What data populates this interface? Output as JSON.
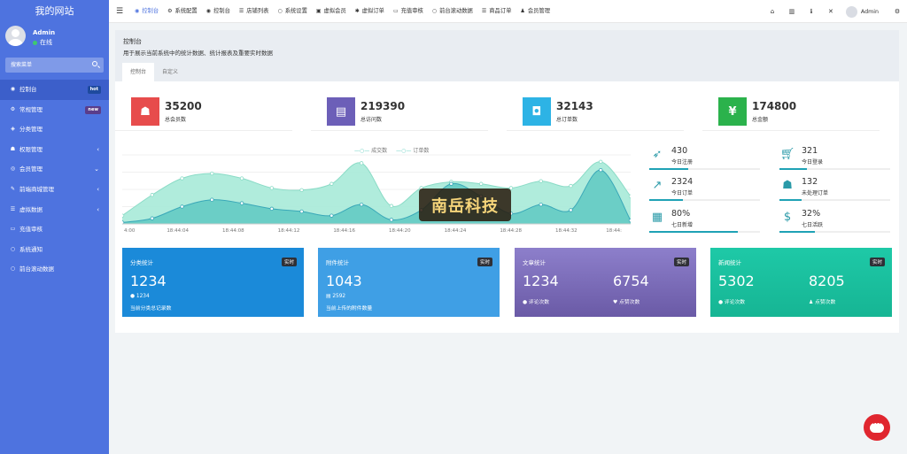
{
  "sidebar": {
    "logo": "我的网站",
    "user_name": "Admin",
    "user_status": "在线",
    "search_placeholder": "搜索菜单",
    "items": [
      {
        "label": "控制台",
        "icon": "dashboard-icon",
        "badge": "hot"
      },
      {
        "label": "常规管理",
        "icon": "cogs-icon",
        "badge": "new"
      },
      {
        "label": "分类管理",
        "icon": "tags-icon"
      },
      {
        "label": "权限管理",
        "icon": "group-icon",
        "arrow": "‹"
      },
      {
        "label": "会员管理",
        "icon": "user-circle-icon",
        "arrow": "⌄"
      },
      {
        "label": "前端商城管理",
        "icon": "magic-icon",
        "arrow": "‹"
      },
      {
        "label": "虚拟数据",
        "icon": "list-icon",
        "arrow": "‹"
      },
      {
        "label": "充值审核",
        "icon": "keyboard-icon"
      },
      {
        "label": "系统通知",
        "icon": "circle-icon"
      },
      {
        "label": "前台滚动数据",
        "icon": "circle-icon"
      }
    ]
  },
  "topbar": {
    "tabs": [
      {
        "label": "控制台",
        "icon": "dashboard-icon"
      },
      {
        "label": "系统配置",
        "icon": "gear-icon"
      },
      {
        "label": "控制台",
        "icon": "dashboard-icon"
      },
      {
        "label": "店铺列表",
        "icon": "list-icon"
      },
      {
        "label": "系统设置",
        "icon": "circle-icon"
      },
      {
        "label": "虚拟会员",
        "icon": "square-icon"
      },
      {
        "label": "虚拟订单",
        "icon": "asterisk-icon"
      },
      {
        "label": "充值审核",
        "icon": "keyboard-icon"
      },
      {
        "label": "前台滚动数据",
        "icon": "circle-icon"
      },
      {
        "label": "商品订单",
        "icon": "list-icon"
      },
      {
        "label": "会员管理",
        "icon": "user-icon"
      }
    ],
    "admin_name": "Admin"
  },
  "panel": {
    "title": "控制台",
    "description": "用于展示当前系统中的统计数据、统计报表及重要实时数据",
    "tabs": [
      "控制台",
      "自定义"
    ]
  },
  "stats": [
    {
      "value": "35200",
      "label": "总会员数",
      "color": "#e74c4c",
      "icon": "users-icon"
    },
    {
      "value": "219390",
      "label": "总访问数",
      "color": "#6c5fb8",
      "icon": "book-icon"
    },
    {
      "value": "32143",
      "label": "总订单数",
      "color": "#2db3e5",
      "icon": "shopping-bag-icon"
    },
    {
      "value": "174800",
      "label": "总金额",
      "color": "#2bb24c",
      "icon": "yen-icon"
    }
  ],
  "chart_data": {
    "type": "area",
    "legend": [
      "成交数",
      "订单数"
    ],
    "x": [
      "4:00",
      "18:44:04",
      "18:44:08",
      "18:44:12",
      "18:44:16",
      "18:44:20",
      "18:44:24",
      "18:44:28",
      "18:44:32",
      "18:44:"
    ],
    "series": [
      {
        "name": "订单数",
        "color": "#a7ead8",
        "values": [
          12,
          42,
          66,
          73,
          66,
          52,
          49,
          58,
          88,
          26,
          52,
          61,
          58,
          52,
          62,
          55,
          90,
          40
        ]
      },
      {
        "name": "成交数",
        "color": "#5fc9c2",
        "values": [
          2,
          8,
          25,
          35,
          30,
          22,
          18,
          12,
          28,
          6,
          20,
          58,
          40,
          15,
          28,
          20,
          78,
          5
        ]
      }
    ],
    "ylim": [
      0,
      100
    ],
    "watermark": "南岳科技"
  },
  "right_stats": [
    {
      "value": "430",
      "label": "今日注册",
      "icon": "rocket-icon",
      "progress": 0.35
    },
    {
      "value": "321",
      "label": "今日登录",
      "icon": "cart-icon",
      "progress": 0.25
    },
    {
      "value": "2324",
      "label": "今日订单",
      "icon": "line-chart-icon",
      "progress": 0.3
    },
    {
      "value": "132",
      "label": "未处理订单",
      "icon": "users-icon",
      "progress": 0.2
    },
    {
      "value": "80%",
      "label": "七日新增",
      "icon": "calendar-icon",
      "progress": 0.8
    },
    {
      "value": "32%",
      "label": "七日活跃",
      "icon": "dollar-icon",
      "progress": 0.32
    }
  ],
  "cards": [
    {
      "title": "分类统计",
      "badge": "实时",
      "color": "#1b8ad9",
      "big1": "1234",
      "small1": "1234",
      "small1_icon": "comment-icon",
      "note": "当前分类总记录数"
    },
    {
      "title": "附件统计",
      "badge": "实时",
      "color": "#3f9fe5",
      "big1": "1043",
      "small1": "2592",
      "small1_icon": "file-icon",
      "note": "当前上传的附件数量"
    },
    {
      "title": "文章统计",
      "badge": "实时",
      "color": "#7a6db8",
      "big1": "1234",
      "big2": "6754",
      "small1": "评论次数",
      "small1_icon": "comment-icon",
      "small2": "点赞次数",
      "small2_icon": "heart-icon"
    },
    {
      "title": "新闻统计",
      "badge": "实时",
      "color": "#1bc3a0",
      "big1": "5302",
      "big2": "8205",
      "small1": "评论次数",
      "small1_icon": "comment-icon",
      "small2": "点赞次数",
      "small2_icon": "user-icon"
    }
  ]
}
